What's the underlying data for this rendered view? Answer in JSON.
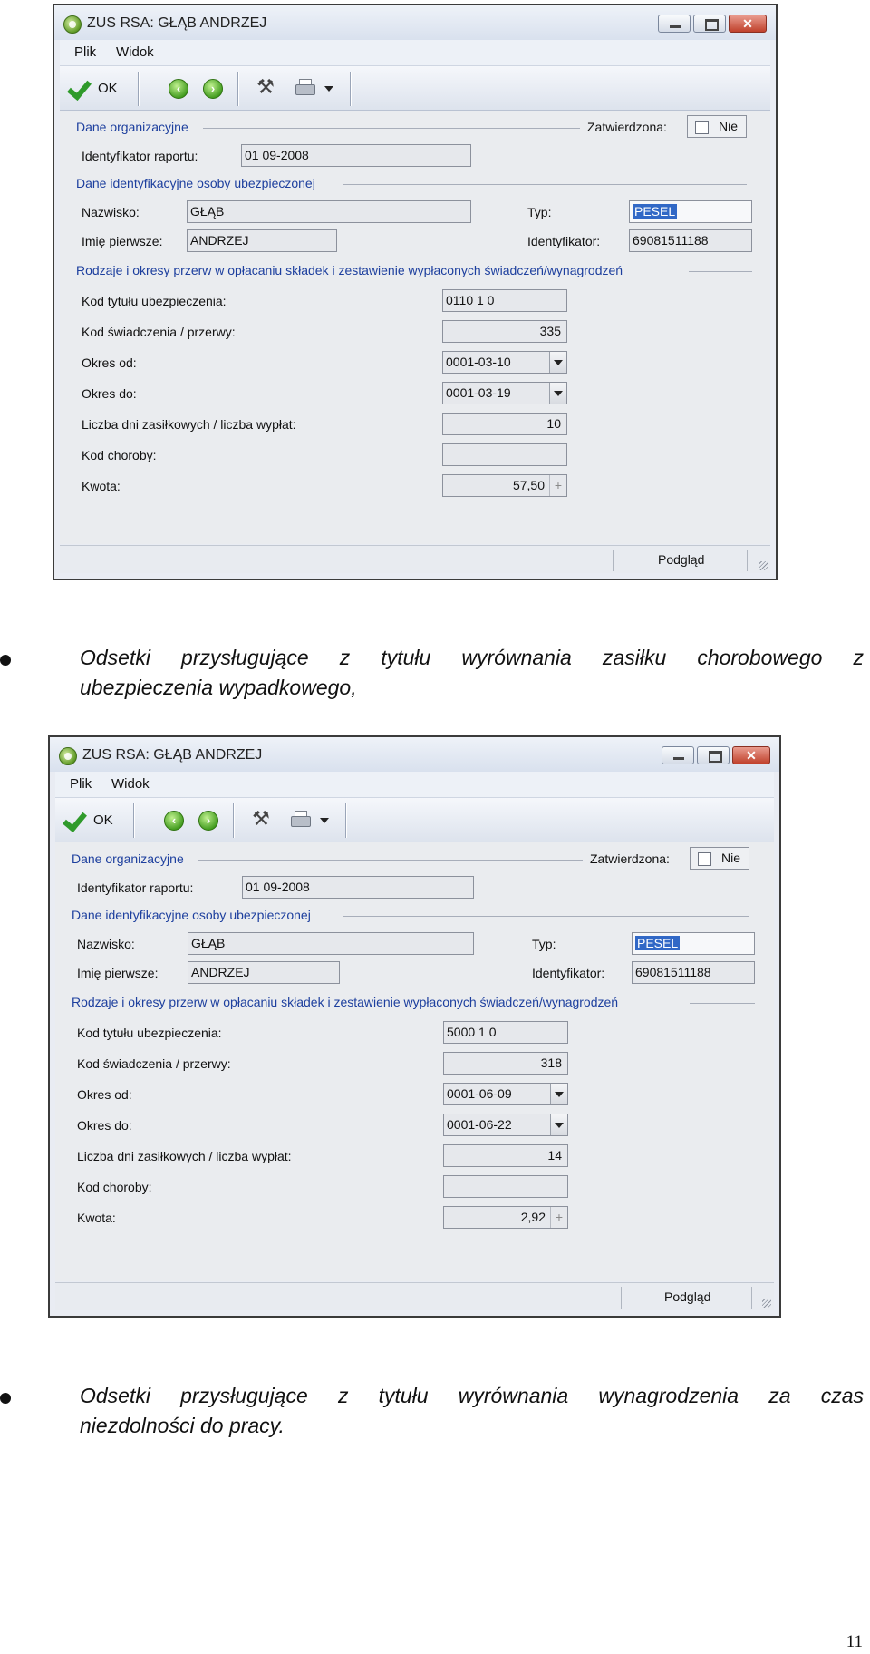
{
  "windows": [
    {
      "title": "ZUS RSA: GŁĄB ANDRZEJ",
      "menu": [
        "Plik",
        "Widok"
      ],
      "toolbar": {
        "ok_label": "OK"
      },
      "sections": {
        "org": "Dane organizacyjne",
        "ident": "Dane identyfikacyjne osoby ubezpieczonej",
        "breaks": "Rodzaje i okresy przerw w opłacaniu składek i zestawienie wypłaconych świadczeń/wynagrodzeń"
      },
      "approved": {
        "label": "Zatwierdzona:",
        "value": "Nie"
      },
      "report_id": {
        "label": "Identyfikator raportu:",
        "value": "01 09-2008"
      },
      "surname": {
        "label": "Nazwisko:",
        "value": "GŁĄB"
      },
      "first_name": {
        "label": "Imię pierwsze:",
        "value": "ANDRZEJ"
      },
      "type": {
        "label": "Typ:",
        "value": "PESEL"
      },
      "identifier": {
        "label": "Identyfikator:",
        "value": "69081511188"
      },
      "insurance_code": {
        "label": "Kod tytułu ubezpieczenia:",
        "value": "0110 1 0"
      },
      "benefit_code": {
        "label": "Kod świadczenia / przerwy:",
        "value": "335"
      },
      "period_from": {
        "label": "Okres od:",
        "value": "0001-03-10"
      },
      "period_to": {
        "label": "Okres do:",
        "value": "0001-03-19"
      },
      "days": {
        "label": "Liczba dni zasiłkowych / liczba wypłat:",
        "value": "10"
      },
      "disease_code": {
        "label": "Kod choroby:",
        "value": ""
      },
      "amount": {
        "label": "Kwota:",
        "value": "57,50"
      },
      "status": {
        "preview": "Podgląd"
      }
    },
    {
      "title": "ZUS RSA: GŁĄB ANDRZEJ",
      "menu": [
        "Plik",
        "Widok"
      ],
      "toolbar": {
        "ok_label": "OK"
      },
      "sections": {
        "org": "Dane organizacyjne",
        "ident": "Dane identyfikacyjne osoby ubezpieczonej",
        "breaks": "Rodzaje i okresy przerw w opłacaniu składek i zestawienie wypłaconych świadczeń/wynagrodzeń"
      },
      "approved": {
        "label": "Zatwierdzona:",
        "value": "Nie"
      },
      "report_id": {
        "label": "Identyfikator raportu:",
        "value": "01 09-2008"
      },
      "surname": {
        "label": "Nazwisko:",
        "value": "GŁĄB"
      },
      "first_name": {
        "label": "Imię pierwsze:",
        "value": "ANDRZEJ"
      },
      "type": {
        "label": "Typ:",
        "value": "PESEL"
      },
      "identifier": {
        "label": "Identyfikator:",
        "value": "69081511188"
      },
      "insurance_code": {
        "label": "Kod tytułu ubezpieczenia:",
        "value": "5000 1 0"
      },
      "benefit_code": {
        "label": "Kod świadczenia / przerwy:",
        "value": "318"
      },
      "period_from": {
        "label": "Okres od:",
        "value": "0001-06-09"
      },
      "period_to": {
        "label": "Okres do:",
        "value": "0001-06-22"
      },
      "days": {
        "label": "Liczba dni zasiłkowych / liczba wypłat:",
        "value": "14"
      },
      "disease_code": {
        "label": "Kod choroby:",
        "value": ""
      },
      "amount": {
        "label": "Kwota:",
        "value": "2,92"
      },
      "status": {
        "preview": "Podgląd"
      }
    }
  ],
  "bullets": [
    {
      "line1": "Odsetki przysługujące z tytułu wyrównania zasiłku chorobowego z",
      "line2": "ubezpieczenia wypadkowego,"
    },
    {
      "line1": "Odsetki przysługujące z tytułu wyrównania wynagrodzenia za czas",
      "line2": "niezdolności do pracy."
    }
  ],
  "page_number": "11"
}
